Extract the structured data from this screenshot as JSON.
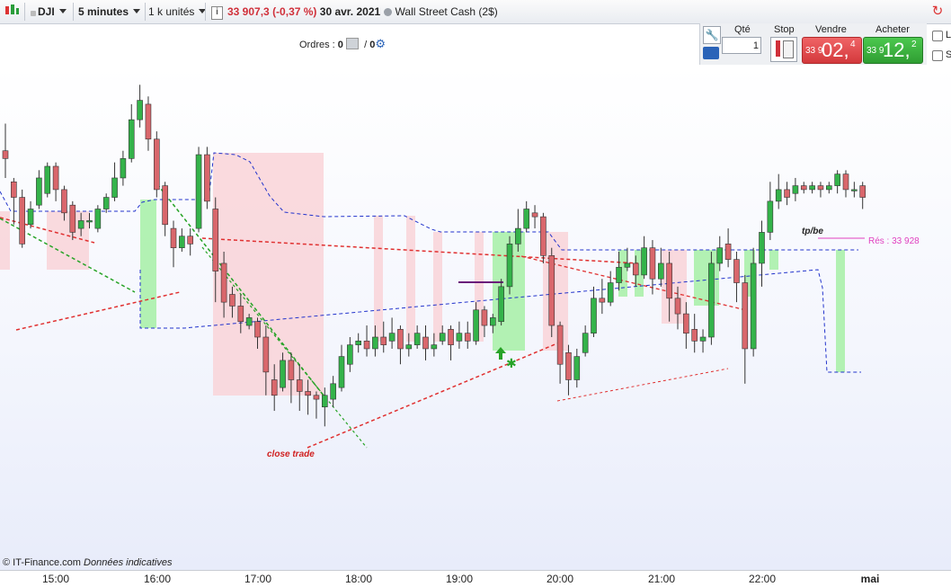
{
  "toolbar": {
    "instrument": "DJI",
    "timeframe": "5 minutes",
    "units": "1 k unités",
    "price": "33 907,3",
    "change": "(-0,37 %)",
    "date": "30 avr. 2021",
    "market_name": "Wall Street Cash (2$)"
  },
  "orders": {
    "label": "Ordres :",
    "count1": "0",
    "slash": "/",
    "count2": "0"
  },
  "trade_panel": {
    "qty_label": "Qté",
    "qty_value": "1",
    "stop_label": "Stop",
    "sell_label": "Vendre",
    "sell_prefix": "33 9",
    "sell_big": "02,",
    "sell_sup": "4",
    "buy_label": "Acheter",
    "buy_prefix": "33 9",
    "buy_big": "12,",
    "buy_sup": "2",
    "check1": "L",
    "check2": "S"
  },
  "annotations": {
    "tp_be": "tp/be",
    "resistance": "Rés : 33 928",
    "close_trade": "close trade"
  },
  "credit": {
    "brand": "© IT-Finance.com",
    "note": "Données indicatives"
  },
  "x_axis": [
    "15:00",
    "16:00",
    "17:00",
    "18:00",
    "19:00",
    "20:00",
    "21:00",
    "22:00",
    "mai"
  ],
  "colors": {
    "up": "#34b34a",
    "down": "#d9676c",
    "up_zone": "#a6f0a6",
    "down_zone": "#f9d3d8",
    "sell": "#d3393c",
    "buy": "#2f9e32"
  },
  "chart_data": {
    "type": "candlestick",
    "title": "",
    "xlabel": "",
    "ylabel": "",
    "candles": [
      [
        0.55,
        0.53,
        0.48,
        0.62
      ],
      [
        0.47,
        0.43,
        0.36,
        0.48
      ],
      [
        0.43,
        0.31,
        0.3,
        0.45
      ],
      [
        0.36,
        0.4,
        0.35,
        0.42
      ],
      [
        0.41,
        0.48,
        0.4,
        0.5
      ],
      [
        0.44,
        0.51,
        0.43,
        0.52
      ],
      [
        0.51,
        0.45,
        0.42,
        0.52
      ],
      [
        0.45,
        0.39,
        0.37,
        0.46
      ],
      [
        0.41,
        0.34,
        0.32,
        0.42
      ],
      [
        0.35,
        0.37,
        0.33,
        0.39
      ],
      [
        0.37,
        0.37,
        0.35,
        0.39
      ],
      [
        0.35,
        0.4,
        0.34,
        0.41
      ],
      [
        0.4,
        0.43,
        0.39,
        0.44
      ],
      [
        0.43,
        0.48,
        0.42,
        0.52
      ],
      [
        0.48,
        0.53,
        0.46,
        0.55
      ],
      [
        0.53,
        0.63,
        0.52,
        0.67
      ],
      [
        0.63,
        0.68,
        0.61,
        0.72
      ],
      [
        0.67,
        0.58,
        0.55,
        0.69
      ],
      [
        0.58,
        0.45,
        0.43,
        0.6
      ],
      [
        0.46,
        0.36,
        0.33,
        0.47
      ],
      [
        0.35,
        0.3,
        0.25,
        0.37
      ],
      [
        0.3,
        0.33,
        0.29,
        0.35
      ],
      [
        0.33,
        0.31,
        0.28,
        0.35
      ],
      [
        0.35,
        0.54,
        0.34,
        0.56
      ],
      [
        0.54,
        0.42,
        0.4,
        0.56
      ],
      [
        0.4,
        0.24,
        0.16,
        0.43
      ],
      [
        0.26,
        0.16,
        0.12,
        0.29
      ],
      [
        0.18,
        0.15,
        0.12,
        0.2
      ],
      [
        0.15,
        0.11,
        0.08,
        0.18
      ],
      [
        0.1,
        0.12,
        0.09,
        0.13
      ],
      [
        0.11,
        0.07,
        0.04,
        0.12
      ],
      [
        0.07,
        -0.02,
        -0.08,
        0.1
      ],
      [
        -0.04,
        -0.08,
        -0.12,
        0.0
      ],
      [
        -0.06,
        0.01,
        -0.07,
        0.03
      ],
      [
        0.01,
        -0.04,
        -0.1,
        0.03
      ],
      [
        -0.04,
        -0.07,
        -0.12,
        0.0
      ],
      [
        -0.07,
        -0.08,
        -0.13,
        -0.04
      ],
      [
        -0.08,
        -0.09,
        -0.14,
        -0.07
      ],
      [
        -0.11,
        -0.08,
        -0.16,
        -0.06
      ],
      [
        -0.09,
        -0.05,
        -0.11,
        -0.03
      ],
      [
        -0.06,
        0.02,
        -0.07,
        0.05
      ],
      [
        0.0,
        0.05,
        -0.02,
        0.07
      ],
      [
        0.05,
        0.06,
        0.03,
        0.08
      ],
      [
        0.06,
        0.04,
        0.02,
        0.1
      ],
      [
        0.04,
        0.07,
        0.02,
        0.1
      ],
      [
        0.07,
        0.05,
        0.03,
        0.11
      ],
      [
        0.06,
        0.08,
        0.04,
        0.12
      ],
      [
        0.09,
        0.04,
        0.0,
        0.1
      ],
      [
        0.04,
        0.05,
        0.02,
        0.08
      ],
      [
        0.05,
        0.08,
        0.04,
        0.1
      ],
      [
        0.07,
        0.04,
        0.01,
        0.1
      ],
      [
        0.04,
        0.05,
        0.02,
        0.08
      ],
      [
        0.06,
        0.08,
        0.05,
        0.1
      ],
      [
        0.09,
        0.05,
        0.01,
        0.1
      ],
      [
        0.06,
        0.08,
        0.04,
        0.11
      ],
      [
        0.08,
        0.06,
        0.04,
        0.11
      ],
      [
        0.06,
        0.14,
        0.05,
        0.16
      ],
      [
        0.14,
        0.1,
        0.07,
        0.15
      ],
      [
        0.1,
        0.12,
        0.08,
        0.13
      ],
      [
        0.11,
        0.2,
        0.1,
        0.22
      ],
      [
        0.2,
        0.31,
        0.18,
        0.33
      ],
      [
        0.31,
        0.35,
        0.29,
        0.4
      ],
      [
        0.35,
        0.4,
        0.34,
        0.42
      ],
      [
        0.39,
        0.38,
        0.35,
        0.41
      ],
      [
        0.38,
        0.28,
        0.26,
        0.39
      ],
      [
        0.28,
        0.1,
        0.07,
        0.3
      ],
      [
        0.1,
        0.0,
        -0.05,
        0.11
      ],
      [
        0.03,
        -0.04,
        -0.08,
        0.05
      ],
      [
        -0.04,
        0.02,
        -0.06,
        0.04
      ],
      [
        0.03,
        0.08,
        0.02,
        0.1
      ],
      [
        0.08,
        0.17,
        0.07,
        0.2
      ],
      [
        0.17,
        0.16,
        0.13,
        0.22
      ],
      [
        0.16,
        0.21,
        0.15,
        0.24
      ],
      [
        0.21,
        0.25,
        0.19,
        0.29
      ],
      [
        0.25,
        0.26,
        0.24,
        0.3
      ],
      [
        0.26,
        0.23,
        0.2,
        0.28
      ],
      [
        0.23,
        0.3,
        0.22,
        0.33
      ],
      [
        0.3,
        0.22,
        0.18,
        0.32
      ],
      [
        0.22,
        0.26,
        0.2,
        0.3
      ],
      [
        0.26,
        0.17,
        0.11,
        0.29
      ],
      [
        0.17,
        0.13,
        0.09,
        0.2
      ],
      [
        0.13,
        0.08,
        0.04,
        0.16
      ],
      [
        0.09,
        0.06,
        0.03,
        0.13
      ],
      [
        0.06,
        0.07,
        0.03,
        0.09
      ],
      [
        0.07,
        0.26,
        0.05,
        0.29
      ],
      [
        0.26,
        0.3,
        0.24,
        0.33
      ],
      [
        0.31,
        0.27,
        0.25,
        0.35
      ],
      [
        0.27,
        0.21,
        0.16,
        0.29
      ],
      [
        0.21,
        0.04,
        -0.05,
        0.23
      ],
      [
        0.04,
        0.26,
        0.02,
        0.3
      ],
      [
        0.26,
        0.34,
        0.2,
        0.37
      ],
      [
        0.34,
        0.42,
        0.32,
        0.47
      ],
      [
        0.42,
        0.45,
        0.4,
        0.49
      ],
      [
        0.45,
        0.43,
        0.41,
        0.47
      ],
      [
        0.44,
        0.46,
        0.42,
        0.48
      ],
      [
        0.46,
        0.45,
        0.44,
        0.47
      ],
      [
        0.45,
        0.46,
        0.44,
        0.47
      ],
      [
        0.46,
        0.45,
        0.43,
        0.47
      ],
      [
        0.45,
        0.46,
        0.44,
        0.47
      ],
      [
        0.46,
        0.49,
        0.44,
        0.5
      ],
      [
        0.49,
        0.45,
        0.43,
        0.5
      ],
      [
        0.45,
        0.45,
        0.43,
        0.47
      ],
      [
        0.46,
        0.43,
        0.4,
        0.47
      ]
    ]
  }
}
